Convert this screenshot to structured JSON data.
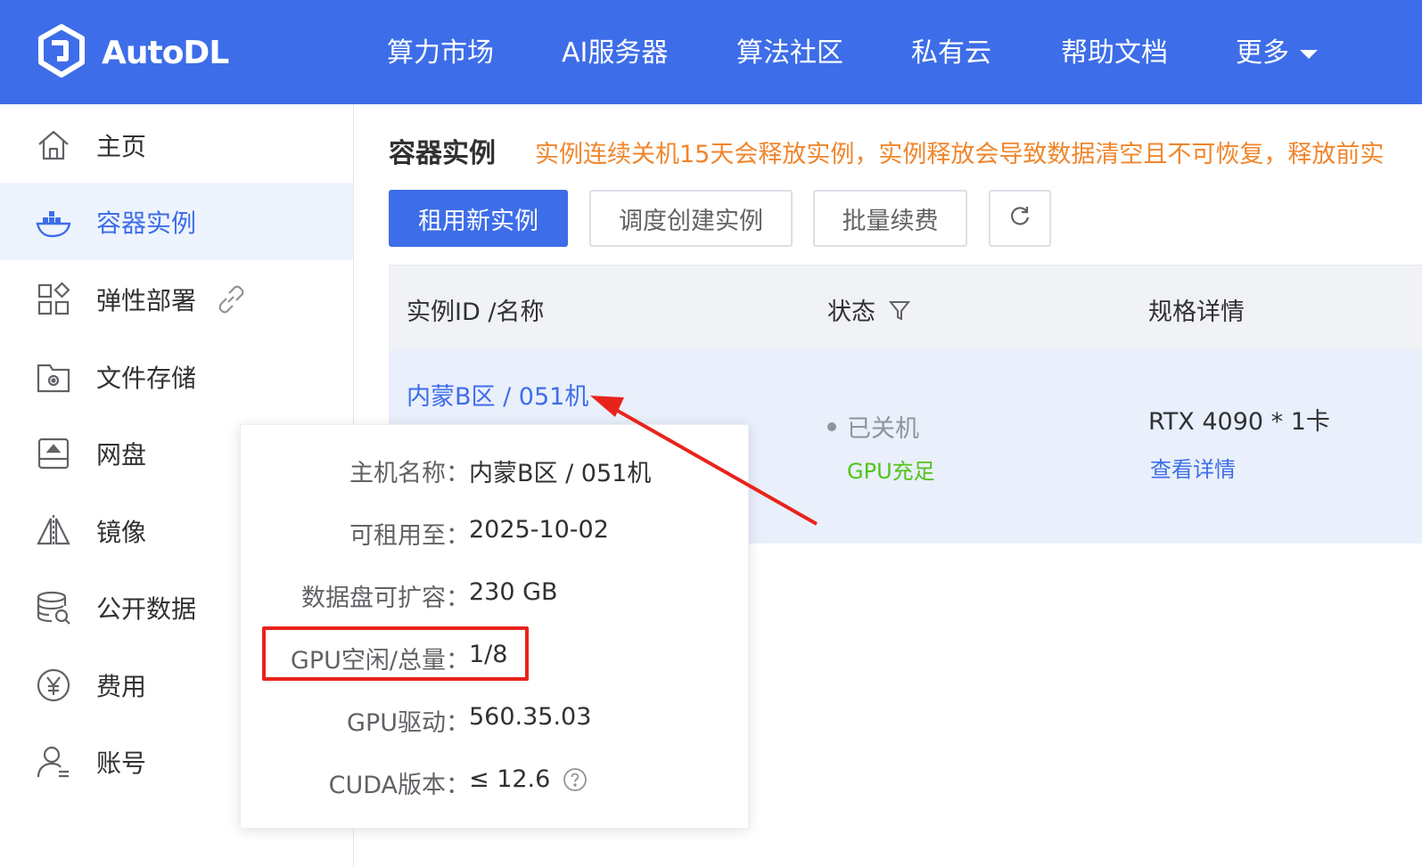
{
  "brand": {
    "name": "AutoDL"
  },
  "nav": {
    "items": [
      "算力市场",
      "AI服务器",
      "算法社区",
      "私有云",
      "帮助文档"
    ],
    "more_label": "更多"
  },
  "sidebar": {
    "items": [
      {
        "label": "主页",
        "icon": "home-icon"
      },
      {
        "label": "容器实例",
        "icon": "container-icon",
        "active": true
      },
      {
        "label": "弹性部署",
        "icon": "apps-grid-icon"
      },
      {
        "label": "文件存储",
        "icon": "file-storage-icon"
      },
      {
        "label": "网盘",
        "icon": "cloud-drive-icon"
      },
      {
        "label": "镜像",
        "icon": "mirror-icon"
      },
      {
        "label": "公开数据",
        "icon": "database-icon"
      },
      {
        "label": "费用",
        "icon": "yen-icon"
      },
      {
        "label": "账号",
        "icon": "user-icon"
      }
    ]
  },
  "main": {
    "title": "容器实例",
    "notice": "实例连续关机15天会释放实例，实例释放会导致数据清空且不可恢复，释放前实",
    "buttons": {
      "new_instance": "租用新实例",
      "schedule_create": "调度创建实例",
      "batch_renew": "批量续费"
    },
    "table": {
      "headers": {
        "id_name": "实例ID /名称",
        "status": "状态",
        "spec": "规格详情"
      },
      "rows": [
        {
          "name": "内蒙B区 / 051机",
          "status": "已关机",
          "gpu_status": "GPU充足",
          "spec": "RTX 4090 * 1卡",
          "detail_link": "查看详情"
        }
      ]
    }
  },
  "popover": {
    "rows": [
      {
        "label": "主机名称：",
        "value": "内蒙B区 / 051机"
      },
      {
        "label": "可租用至：",
        "value": "2025-10-02"
      },
      {
        "label": "数据盘可扩容：",
        "value": "230 GB"
      },
      {
        "label": "GPU空闲/总量：",
        "value": "1/8"
      },
      {
        "label": "GPU驱动：",
        "value": "560.35.03"
      },
      {
        "label": "CUDA版本：",
        "value": "≤ 12.6"
      }
    ]
  },
  "colors": {
    "primary": "#3d6de8",
    "notice": "#f0862c",
    "success": "#52c41a",
    "annotation": "#e8231b"
  }
}
